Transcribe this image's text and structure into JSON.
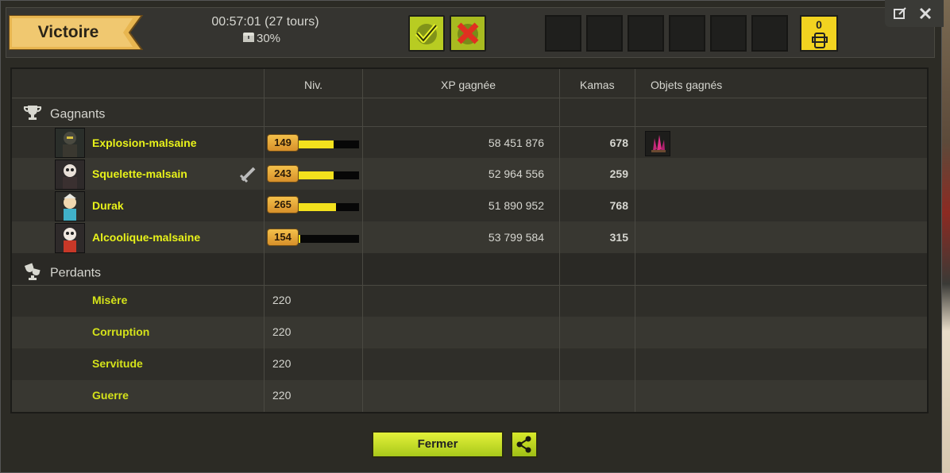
{
  "header": {
    "result_label": "Victoire",
    "timer": "00:57:01 (27 tours)",
    "chest_percent": "30%",
    "badge_count": "0"
  },
  "table": {
    "columns": [
      "Niv.",
      "XP gagnée",
      "Kamas",
      "Objets gagnés"
    ],
    "winners_label": "Gagnants",
    "losers_label": "Perdants",
    "winners": [
      {
        "name": "Explosion-malsaine",
        "level": "149",
        "xp": "58 451 876",
        "kamas": "678",
        "xp_fill": 0.58,
        "has_item": true
      },
      {
        "name": "Squelette-malsain",
        "level": "243",
        "xp": "52 964 556",
        "kamas": "259",
        "xp_fill": 0.58,
        "has_item": false
      },
      {
        "name": "Durak",
        "level": "265",
        "xp": "51 890 952",
        "kamas": "768",
        "xp_fill": 0.62,
        "has_item": false
      },
      {
        "name": "Alcoolique-malsaine",
        "level": "154",
        "xp": "53 799 584",
        "kamas": "315",
        "xp_fill": 0.02,
        "has_item": false
      }
    ],
    "losers": [
      {
        "name": "Misère",
        "level": "220"
      },
      {
        "name": "Corruption",
        "level": "220"
      },
      {
        "name": "Servitude",
        "level": "220"
      },
      {
        "name": "Guerre",
        "level": "220"
      }
    ]
  },
  "footer": {
    "close_label": "Fermer"
  },
  "colors": {
    "player_name": "#e8f21a",
    "level_badge": "#f2d320",
    "xp_bar": "#f3e11d"
  }
}
